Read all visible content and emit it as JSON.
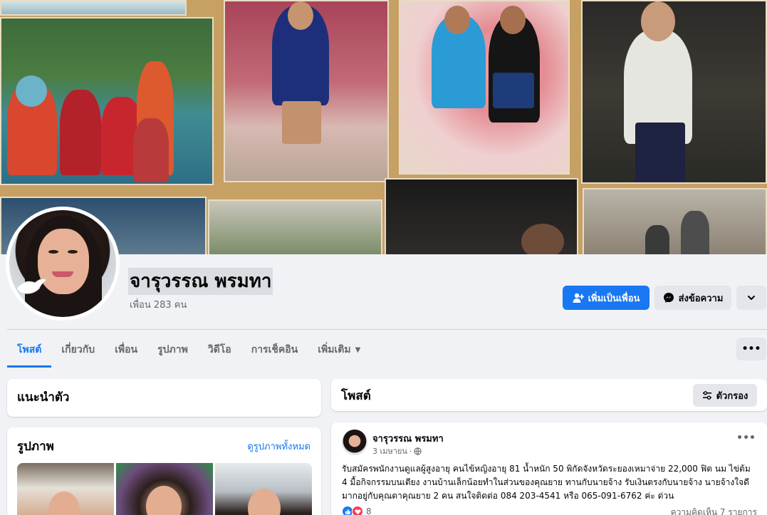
{
  "profile": {
    "name": "จารุวรรณ พรมทา",
    "friends_count": "เพื่อน 283 คน"
  },
  "actions": {
    "add_friend": "เพิ่มเป็นเพื่อน",
    "message": "ส่งข้อความ"
  },
  "tabs": [
    {
      "label": "โพสต์"
    },
    {
      "label": "เกี่ยวกับ"
    },
    {
      "label": "เพื่อน"
    },
    {
      "label": "รูปภาพ"
    },
    {
      "label": "วิดีโอ"
    },
    {
      "label": "การเช็คอิน"
    },
    {
      "label": "เพิ่มเติม"
    }
  ],
  "intro": {
    "title": "แนะนำตัว"
  },
  "photos": {
    "title": "รูปภาพ",
    "see_all": "ดูรูปภาพทั้งหมด"
  },
  "posts": {
    "title": "โพสต์",
    "filter_label": "ตัวกรอง",
    "items": [
      {
        "author": "จารุวรรณ พรมทา",
        "date": "3 เมษายน",
        "text": "รับสมัครพนักงานดูแลผู้สูงอายุ คนไข้หญิงอายุ 81 น้ำหนัก 50 พิกัดจังหวัดระยองเหมาจ่าย 22,000 ฟิต นม ไข่ต้ม 4 มื้อกิจกรรมบนเตียง งานบ้านเล็กน้อยทำในส่วนของคุณยาย ทานกับนายจ้าง รับเงินตรงกับนายจ้าง นายจ้างใจดีมากอยู่กับคุณตาคุณยาย 2 คน สนใจติดต่อ 084 203-4541 หรือ 065-091-6762 ค่ะ ด่วน",
        "reactions_count": "8",
        "comments_count": "ความคิดเห็น 7 รายการ"
      }
    ]
  },
  "colors": {
    "accent": "#1877f2",
    "secondary_bg": "#e4e6eb",
    "page_bg": "#f0f2f5"
  }
}
